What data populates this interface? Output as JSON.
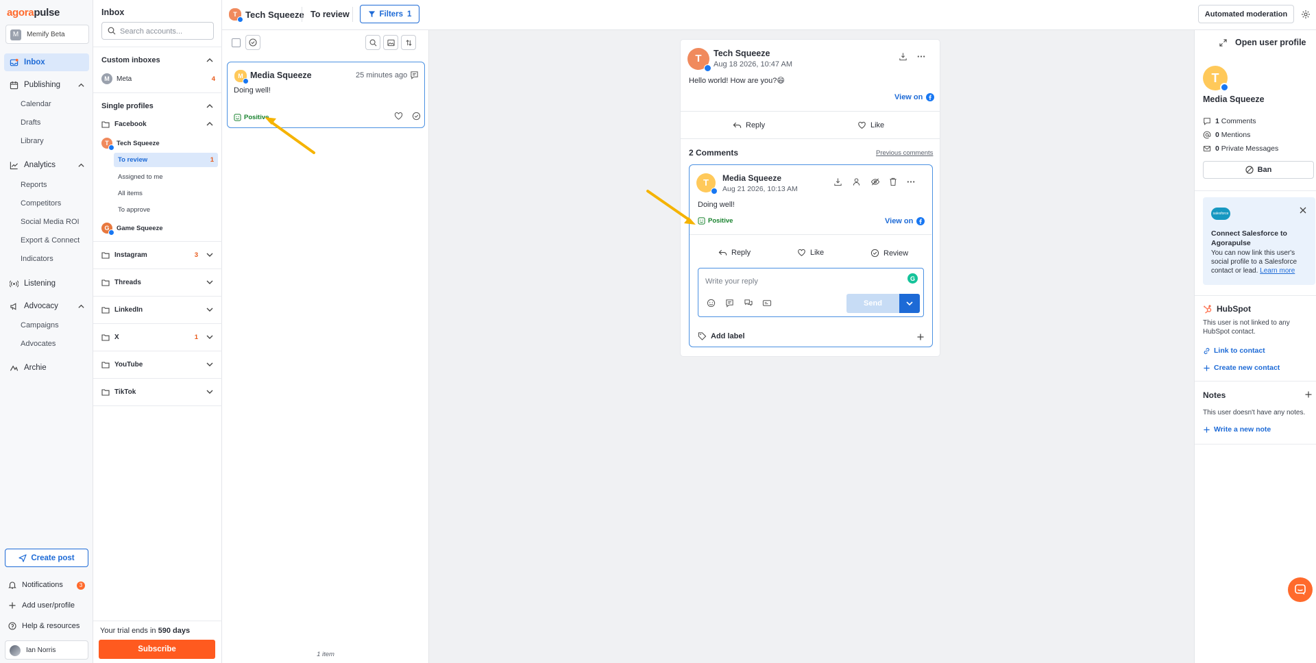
{
  "brand": {
    "logo_a": "agora",
    "logo_b": "pulse",
    "accent": "#ff6a2c",
    "primary": "#1d6ad6"
  },
  "org": {
    "initial": "M",
    "name": "Memify Beta"
  },
  "nav": {
    "inbox": "Inbox",
    "publishing": "Publishing",
    "publishing_sub": [
      "Calendar",
      "Drafts",
      "Library"
    ],
    "analytics": "Analytics",
    "analytics_sub": [
      "Reports",
      "Competitors",
      "Social Media ROI",
      "Export & Connect",
      "Indicators"
    ],
    "listening": "Listening",
    "advocacy": "Advocacy",
    "advocacy_sub": [
      "Campaigns",
      "Advocates"
    ],
    "archie": "Archie"
  },
  "bottom_nav": {
    "create_post": "Create post",
    "notifications": "Notifications",
    "notifications_count": "3",
    "add_user": "Add user/profile",
    "help": "Help & resources",
    "user_name": "Ian Norris"
  },
  "inbox_panel": {
    "title": "Inbox",
    "search_placeholder": "Search accounts...",
    "custom_inboxes": "Custom inboxes",
    "meta": {
      "initial": "M",
      "name": "Meta",
      "count": "4"
    },
    "single_profiles": "Single profiles",
    "facebook": "Facebook",
    "tech_squeeze": {
      "initial": "T",
      "name": "Tech Squeeze"
    },
    "sub_items": [
      {
        "label": "To review",
        "count": "1"
      },
      {
        "label": "Assigned to me",
        "count": ""
      },
      {
        "label": "All items",
        "count": ""
      },
      {
        "label": "To approve",
        "count": ""
      }
    ],
    "game_squeeze": {
      "initial": "G",
      "name": "Game Squeeze"
    },
    "folders": [
      {
        "name": "Instagram",
        "count": "3"
      },
      {
        "name": "Threads",
        "count": ""
      },
      {
        "name": "LinkedIn",
        "count": ""
      },
      {
        "name": "X",
        "count": "1"
      },
      {
        "name": "YouTube",
        "count": ""
      },
      {
        "name": "TikTok",
        "count": ""
      }
    ],
    "trial_prefix": "Your trial ends in ",
    "trial_days": "590 days",
    "subscribe": "Subscribe"
  },
  "topbar": {
    "profile_initial": "T",
    "profile_name": "Tech Squeeze",
    "view": "To review",
    "filters": "Filters",
    "filters_count": "1",
    "automated_moderation": "Automated moderation"
  },
  "item_list": {
    "card": {
      "initial": "M",
      "name": "Media Squeeze",
      "time": "25 minutes ago",
      "text": "Doing well!",
      "sentiment": "Positive"
    },
    "footer": "1 item"
  },
  "detail": {
    "post": {
      "initial": "T",
      "name": "Tech Squeeze",
      "date": "Aug 18 2026, 10:47 AM",
      "text": "Hello world! How are you?😄",
      "view_on": "View on"
    },
    "actions": {
      "reply": "Reply",
      "like": "Like"
    },
    "comments_title": "2 Comments",
    "previous_comments": "Previous comments",
    "comment": {
      "initial": "T",
      "name": "Media Squeeze",
      "date": "Aug 21 2026, 10:13 AM",
      "text": "Doing well!",
      "sentiment": "Positive",
      "view_on": "View on",
      "reply": "Reply",
      "like": "Like",
      "review": "Review",
      "reply_placeholder": "Write your reply",
      "send": "Send",
      "add_label": "Add label"
    }
  },
  "right_panel": {
    "open_profile": "Open user profile",
    "initial": "T",
    "name": "Media Squeeze",
    "stats": [
      {
        "count": "1",
        "label": " Comments"
      },
      {
        "count": "0",
        "label": " Mentions"
      },
      {
        "count": "0",
        "label": " Private Messages"
      }
    ],
    "ban": "Ban",
    "salesforce": {
      "logo": "salesforce",
      "title": "Connect Salesforce to Agorapulse",
      "text": "You can now link this user's social profile to a Salesforce contact or lead. ",
      "link": "Learn more"
    },
    "hubspot": {
      "title": "HubSpot",
      "text": "This user is not linked to any HubSpot contact.",
      "link_contact": "Link to contact",
      "create_contact": "Create new contact"
    },
    "notes": {
      "title": "Notes",
      "text": "This user doesn't have any notes.",
      "write": "Write a new note"
    }
  }
}
